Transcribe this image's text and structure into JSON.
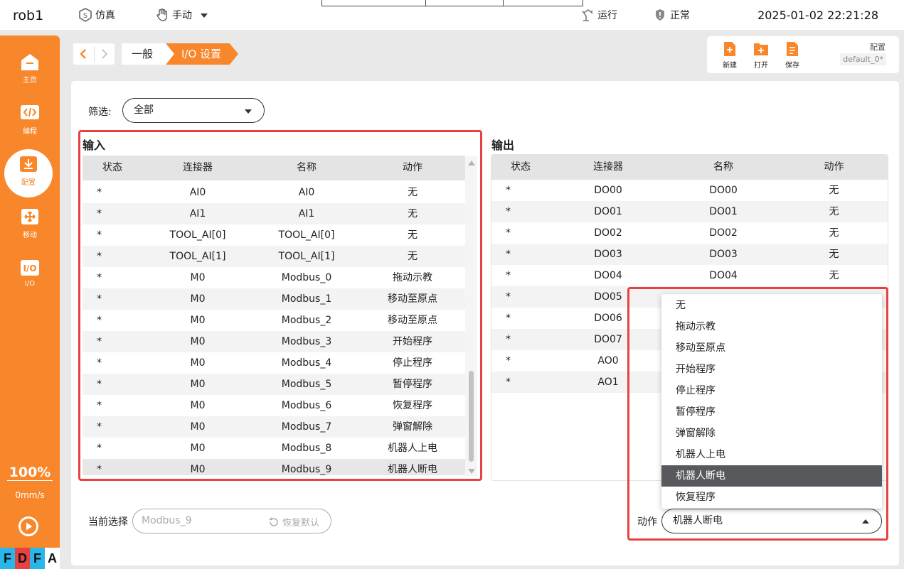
{
  "topbar": {
    "robot_name": "rob1",
    "mode_sim": "仿真",
    "mode_manual": "手动",
    "status_run": "运行",
    "status_normal": "正常",
    "datetime": "2025-01-02 22:21:28"
  },
  "sidebar": {
    "items": [
      {
        "label": "主页",
        "icon": "home-icon"
      },
      {
        "label": "编程",
        "icon": "code-icon"
      },
      {
        "label": "配置",
        "icon": "config-icon"
      },
      {
        "label": "移动",
        "icon": "move-icon"
      },
      {
        "label": "I/O",
        "icon": "io-icon"
      }
    ],
    "active_index": 2,
    "speed_percent": "100%",
    "speed_value": "0mm/s",
    "brand_letters": [
      "F",
      "D",
      "F",
      "A"
    ],
    "brand_colors": [
      "#29b6e8",
      "#e84141",
      "#29b6e8",
      "#ffffff"
    ]
  },
  "breadcrumb": {
    "items": [
      "一般",
      "I/O 设置"
    ]
  },
  "config_toolbar": {
    "buttons": [
      {
        "label": "新建",
        "icon": "new-file-icon"
      },
      {
        "label": "打开",
        "icon": "open-folder-icon"
      },
      {
        "label": "保存",
        "icon": "save-icon"
      }
    ],
    "label": "配置",
    "name": "default_0*"
  },
  "filter": {
    "label": "筛选:",
    "value": "全部"
  },
  "input": {
    "title": "输入",
    "columns": [
      "状态",
      "连接器",
      "名称",
      "动作"
    ],
    "rows": [
      [
        "*",
        "AI0",
        "AI0",
        "无"
      ],
      [
        "*",
        "AI1",
        "AI1",
        "无"
      ],
      [
        "*",
        "TOOL_AI[0]",
        "TOOL_AI[0]",
        "无"
      ],
      [
        "*",
        "TOOL_AI[1]",
        "TOOL_AI[1]",
        "无"
      ],
      [
        "*",
        "M0",
        "Modbus_0",
        "拖动示教"
      ],
      [
        "*",
        "M0",
        "Modbus_1",
        "移动至原点"
      ],
      [
        "*",
        "M0",
        "Modbus_2",
        "移动至原点"
      ],
      [
        "*",
        "M0",
        "Modbus_3",
        "开始程序"
      ],
      [
        "*",
        "M0",
        "Modbus_4",
        "停止程序"
      ],
      [
        "*",
        "M0",
        "Modbus_5",
        "暂停程序"
      ],
      [
        "*",
        "M0",
        "Modbus_6",
        "恢复程序"
      ],
      [
        "*",
        "M0",
        "Modbus_7",
        "弹窗解除"
      ],
      [
        "*",
        "M0",
        "Modbus_8",
        "机器人上电"
      ],
      [
        "*",
        "M0",
        "Modbus_9",
        "机器人断电"
      ]
    ],
    "selected_index": 13
  },
  "output": {
    "title": "输出",
    "columns": [
      "状态",
      "连接器",
      "名称",
      "动作"
    ],
    "rows": [
      [
        "*",
        "DO00",
        "DO00",
        "无"
      ],
      [
        "*",
        "DO01",
        "DO01",
        "无"
      ],
      [
        "*",
        "DO02",
        "DO02",
        "无"
      ],
      [
        "*",
        "DO03",
        "DO03",
        "无"
      ],
      [
        "*",
        "DO04",
        "DO04",
        "无"
      ],
      [
        "*",
        "DO05",
        "",
        ""
      ],
      [
        "*",
        "DO06",
        "",
        ""
      ],
      [
        "*",
        "DO07",
        "",
        ""
      ],
      [
        "*",
        "AO0",
        "",
        ""
      ],
      [
        "*",
        "AO1",
        "",
        ""
      ]
    ]
  },
  "action_dropdown": {
    "options": [
      "无",
      "拖动示教",
      "移动至原点",
      "开始程序",
      "停止程序",
      "暂停程序",
      "弹窗解除",
      "机器人上电",
      "机器人断电",
      "恢复程序"
    ],
    "selected_index": 8
  },
  "footer": {
    "current_label": "当前选择",
    "current_value": "Modbus_9",
    "reset_label": "恢复默认",
    "action_label": "动作",
    "action_value": "机器人断电"
  },
  "colors": {
    "accent": "#f8862a",
    "highlight_box": "#e84141",
    "selected_option": "#58595c"
  }
}
